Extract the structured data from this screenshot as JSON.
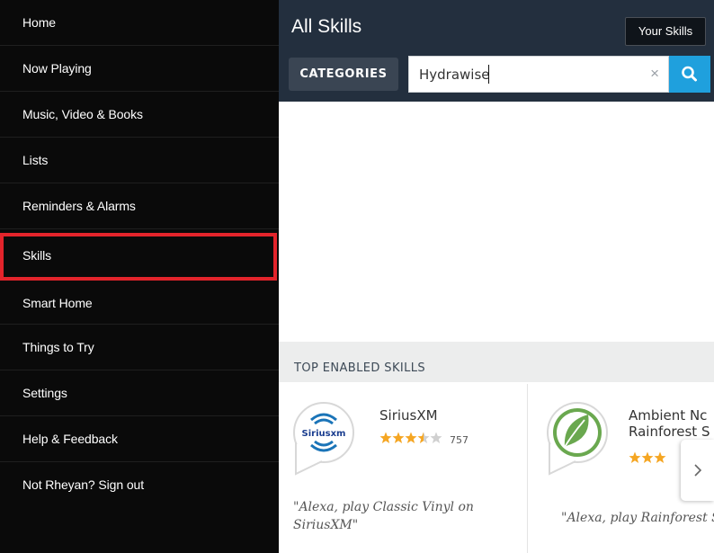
{
  "sidebar": {
    "items": [
      {
        "label": "Home"
      },
      {
        "label": "Now Playing"
      },
      {
        "label": "Music, Video & Books"
      },
      {
        "label": "Lists"
      },
      {
        "label": "Reminders & Alarms"
      },
      {
        "label": "Skills"
      },
      {
        "label": "Smart Home"
      },
      {
        "label": "Things to Try"
      },
      {
        "label": "Settings"
      },
      {
        "label": "Help & Feedback"
      },
      {
        "label": "Not Rheyan? Sign out"
      }
    ],
    "selected_index": 5
  },
  "header": {
    "title": "All Skills",
    "your_skills_label": "Your Skills",
    "categories_label": "CATEGORIES",
    "search_value": "Hydrawise",
    "clear_icon": "×"
  },
  "section": {
    "title": "TOP ENABLED SKILLS"
  },
  "skills": [
    {
      "name": "SiriusXM",
      "logo_text": "Siriusxm",
      "rating": 3.5,
      "review_count": "757",
      "quote": "\"Alexa, play Classic Vinyl on SiriusXM\""
    },
    {
      "name_line1": "Ambient Nc",
      "name_line2": "Rainforest S",
      "rating": 3,
      "quote": "\"Alexa, play Rainforest S"
    }
  ],
  "colors": {
    "sidebar_bg": "#0a0a0a",
    "header_bg": "#232f3e",
    "selected_border": "#e3242b",
    "search_button": "#1fa0dd",
    "star": "#f5a623"
  },
  "icons": {
    "search": "search-icon",
    "clear": "close-icon",
    "next": "chevron-right-icon",
    "sirius_logo": "siriusxm-logo",
    "leaf_logo": "leaf-icon"
  }
}
